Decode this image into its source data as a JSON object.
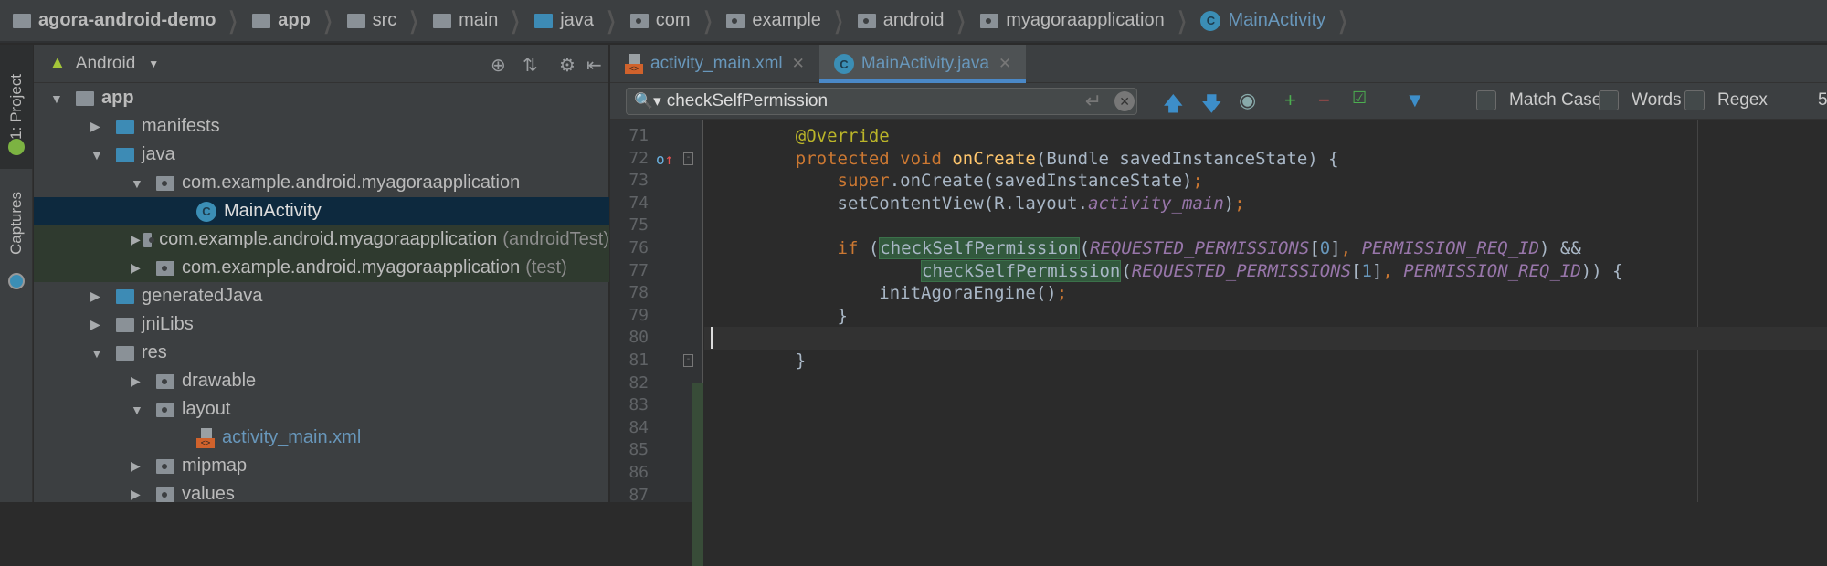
{
  "breadcrumb": [
    {
      "label": "agora-android-demo",
      "icon": "project-folder-icon"
    },
    {
      "label": "app",
      "icon": "module-folder-icon"
    },
    {
      "label": "src",
      "icon": "folder-icon"
    },
    {
      "label": "main",
      "icon": "folder-icon"
    },
    {
      "label": "java",
      "icon": "source-folder-icon"
    },
    {
      "label": "com",
      "icon": "package-icon"
    },
    {
      "label": "example",
      "icon": "package-icon"
    },
    {
      "label": "android",
      "icon": "package-icon"
    },
    {
      "label": "myagoraapplication",
      "icon": "package-icon"
    },
    {
      "label": "MainActivity",
      "icon": "class-icon"
    }
  ],
  "side_tabs": {
    "project": "1: Project",
    "captures": "Captures"
  },
  "project_panel": {
    "view": "Android",
    "tree": [
      {
        "label": "app",
        "depth": 0,
        "expanded": true,
        "icon": "module-folder-icon",
        "bold": true
      },
      {
        "label": "manifests",
        "depth": 1,
        "expanded": false,
        "icon": "folder-icon"
      },
      {
        "label": "java",
        "depth": 1,
        "expanded": true,
        "icon": "source-folder-icon"
      },
      {
        "label": "com.example.android.myagoraapplication",
        "depth": 2,
        "expanded": true,
        "icon": "package-icon"
      },
      {
        "label": "MainActivity",
        "depth": 3,
        "icon": "class-icon",
        "selected": true
      },
      {
        "label": "com.example.android.myagoraapplication",
        "suffix": "(androidTest)",
        "depth": 2,
        "expanded": false,
        "icon": "package-icon",
        "tinted": true
      },
      {
        "label": "com.example.android.myagoraapplication",
        "suffix": "(test)",
        "depth": 2,
        "expanded": false,
        "icon": "package-icon",
        "tinted": true
      },
      {
        "label": "generatedJava",
        "depth": 1,
        "expanded": false,
        "icon": "generated-folder-icon"
      },
      {
        "label": "jniLibs",
        "depth": 1,
        "expanded": false,
        "icon": "resource-folder-icon"
      },
      {
        "label": "res",
        "depth": 1,
        "expanded": true,
        "icon": "resource-folder-icon"
      },
      {
        "label": "drawable",
        "depth": 2,
        "expanded": false,
        "icon": "package-icon"
      },
      {
        "label": "layout",
        "depth": 2,
        "expanded": true,
        "icon": "package-icon"
      },
      {
        "label": "activity_main.xml",
        "depth": 3,
        "icon": "xml-file-icon",
        "link": true
      },
      {
        "label": "mipmap",
        "depth": 2,
        "expanded": false,
        "icon": "package-icon"
      },
      {
        "label": "values",
        "depth": 2,
        "expanded": false,
        "icon": "package-icon"
      }
    ]
  },
  "editor_tabs": [
    {
      "label": "activity_main.xml",
      "active": false
    },
    {
      "label": "MainActivity.java",
      "active": true
    }
  ],
  "find": {
    "query": "checkSelfPermission",
    "match_case": "Match Case",
    "words": "Words",
    "regex": "Regex",
    "match_count": "5"
  },
  "code": {
    "current_line": 80,
    "lines": [
      {
        "n": 71,
        "html": "    <span class='an'>@Override</span>"
      },
      {
        "n": 72,
        "html": "    <span class='kw'>protected void </span><span class='fn'>onCreate</span>(Bundle savedInstanceState) {"
      },
      {
        "n": 73,
        "html": "        <span class='kw'>super</span>.onCreate(savedInstanceState)<span class='kw'>;</span>"
      },
      {
        "n": 74,
        "html": "        setContentView(R.layout.<span class='st'>activity_main</span>)<span class='kw'>;</span>"
      },
      {
        "n": 75,
        "html": ""
      },
      {
        "n": 76,
        "html": "        <span class='kw'>if </span>(<span class='hl'>checkSelfPermission</span>(<span class='st'>REQUESTED_PERMISSIONS</span>[<span class='num'>0</span>]<span class='kw'>, </span><span class='st'>PERMISSION_REQ_ID</span>) &amp;&amp;"
      },
      {
        "n": 77,
        "html": "                <span class='hl'>checkSelfPermission</span>(<span class='st'>REQUESTED_PERMISSIONS</span>[<span class='num'>1</span>]<span class='kw'>, </span><span class='st'>PERMISSION_REQ_ID</span>)) {"
      },
      {
        "n": 78,
        "html": "            initAgoraEngine()<span class='kw'>;</span>"
      },
      {
        "n": 79,
        "html": "        }"
      },
      {
        "n": 80,
        "html": ""
      },
      {
        "n": 81,
        "html": "    }"
      },
      {
        "n": 82,
        "html": ""
      },
      {
        "n": 83,
        "html": ""
      },
      {
        "n": 84,
        "html": ""
      },
      {
        "n": 85,
        "html": ""
      },
      {
        "n": 86,
        "html": ""
      },
      {
        "n": 87,
        "html": ""
      }
    ]
  }
}
